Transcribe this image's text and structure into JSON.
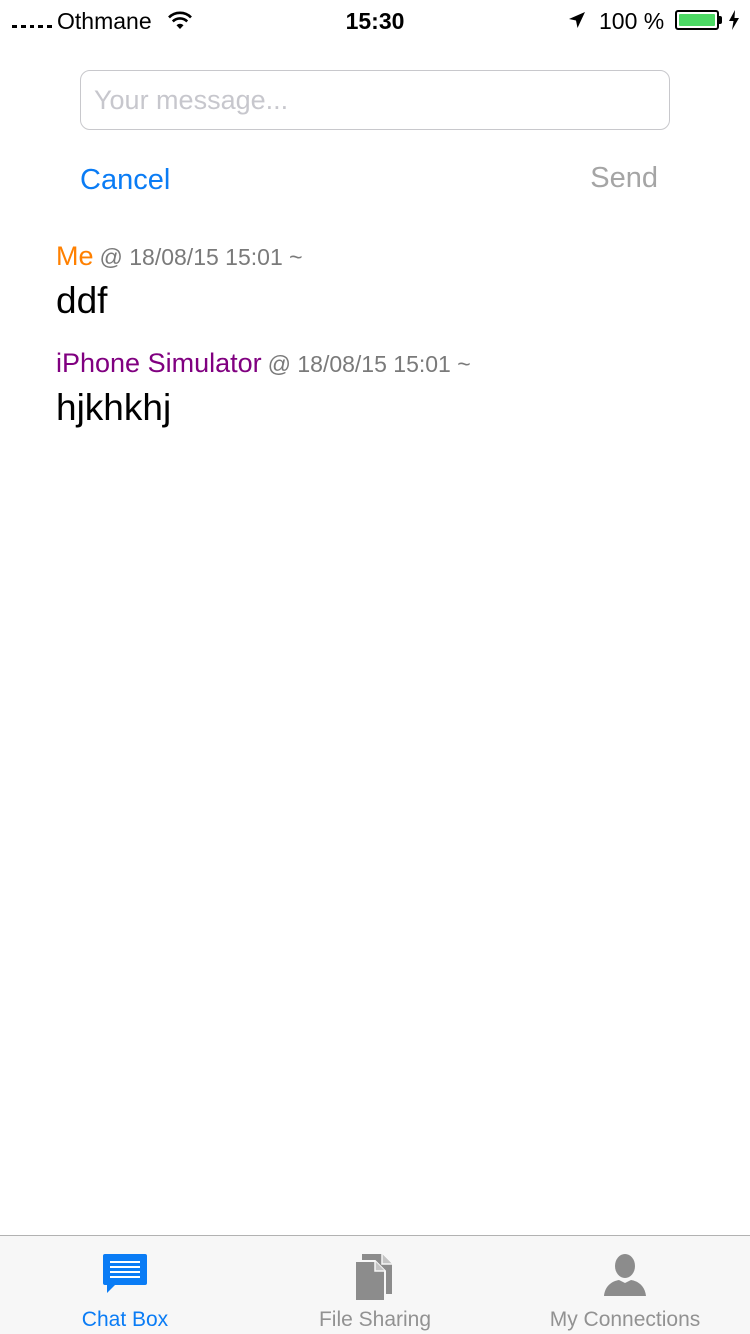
{
  "status_bar": {
    "carrier": "Othmane",
    "time": "15:30",
    "battery_percent": "100 %",
    "battery_level": 1.0,
    "icons": [
      "signal-dots-icon",
      "wifi-icon",
      "location-arrow-icon",
      "battery-icon",
      "charging-bolt-icon"
    ]
  },
  "composer": {
    "placeholder": "Your message...",
    "value": "",
    "cancel_label": "Cancel",
    "send_label": "Send"
  },
  "messages": [
    {
      "sender": "Me",
      "meta": "@ 18/08/15 15:01 ~",
      "text": "ddf",
      "sender_color": "#ff8000"
    },
    {
      "sender": "iPhone Simulator",
      "meta": "@ 18/08/15 15:01 ~",
      "text": "hjkhkhj",
      "sender_color": "#800080"
    }
  ],
  "tabs": [
    {
      "label": "Chat Box",
      "icon": "chat-bubble-icon",
      "active": true
    },
    {
      "label": "File Sharing",
      "icon": "documents-icon",
      "active": false
    },
    {
      "label": "My Connections",
      "icon": "person-icon",
      "active": false
    }
  ],
  "colors": {
    "accent": "#0a7cf5",
    "inactive": "#929292",
    "send_disabled": "#a5a5a5",
    "battery": "#4cd964"
  }
}
